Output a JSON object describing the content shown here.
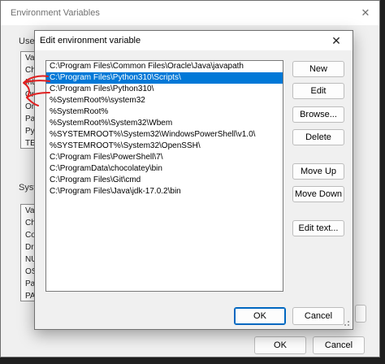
{
  "back_window": {
    "title": "Environment Variables",
    "user_group_label": "User",
    "system_group_label": "System",
    "user_labels": [
      "Va",
      "Ch",
      "Int",
      "Or",
      "Or",
      "Pa",
      "Py",
      "TE"
    ],
    "system_labels": [
      "Va",
      "Ch",
      "Co",
      "Dr",
      "NU",
      "OS",
      "Pa",
      "PA"
    ],
    "ok_label": "OK",
    "cancel_label": "Cancel"
  },
  "dialog": {
    "title": "Edit environment variable",
    "paths": [
      "C:\\Program Files\\Common Files\\Oracle\\Java\\javapath",
      "C:\\Program Files\\Python310\\Scripts\\",
      "C:\\Program Files\\Python310\\",
      "%SystemRoot%\\system32",
      "%SystemRoot%",
      "%SystemRoot%\\System32\\Wbem",
      "%SYSTEMROOT%\\System32\\WindowsPowerShell\\v1.0\\",
      "%SYSTEMROOT%\\System32\\OpenSSH\\",
      "C:\\Program Files\\PowerShell\\7\\",
      "C:\\ProgramData\\chocolatey\\bin",
      "C:\\Program Files\\Git\\cmd",
      "C:\\Program Files\\Java\\jdk-17.0.2\\bin"
    ],
    "selected_index": 1,
    "buttons": {
      "new": "New",
      "edit": "Edit",
      "browse": "Browse...",
      "delete": "Delete",
      "move_up": "Move Up",
      "move_down": "Move Down",
      "edit_text": "Edit text...",
      "ok": "OK",
      "cancel": "Cancel"
    }
  },
  "colors": {
    "selection": "#0078d7",
    "annotation": "#e02020"
  }
}
